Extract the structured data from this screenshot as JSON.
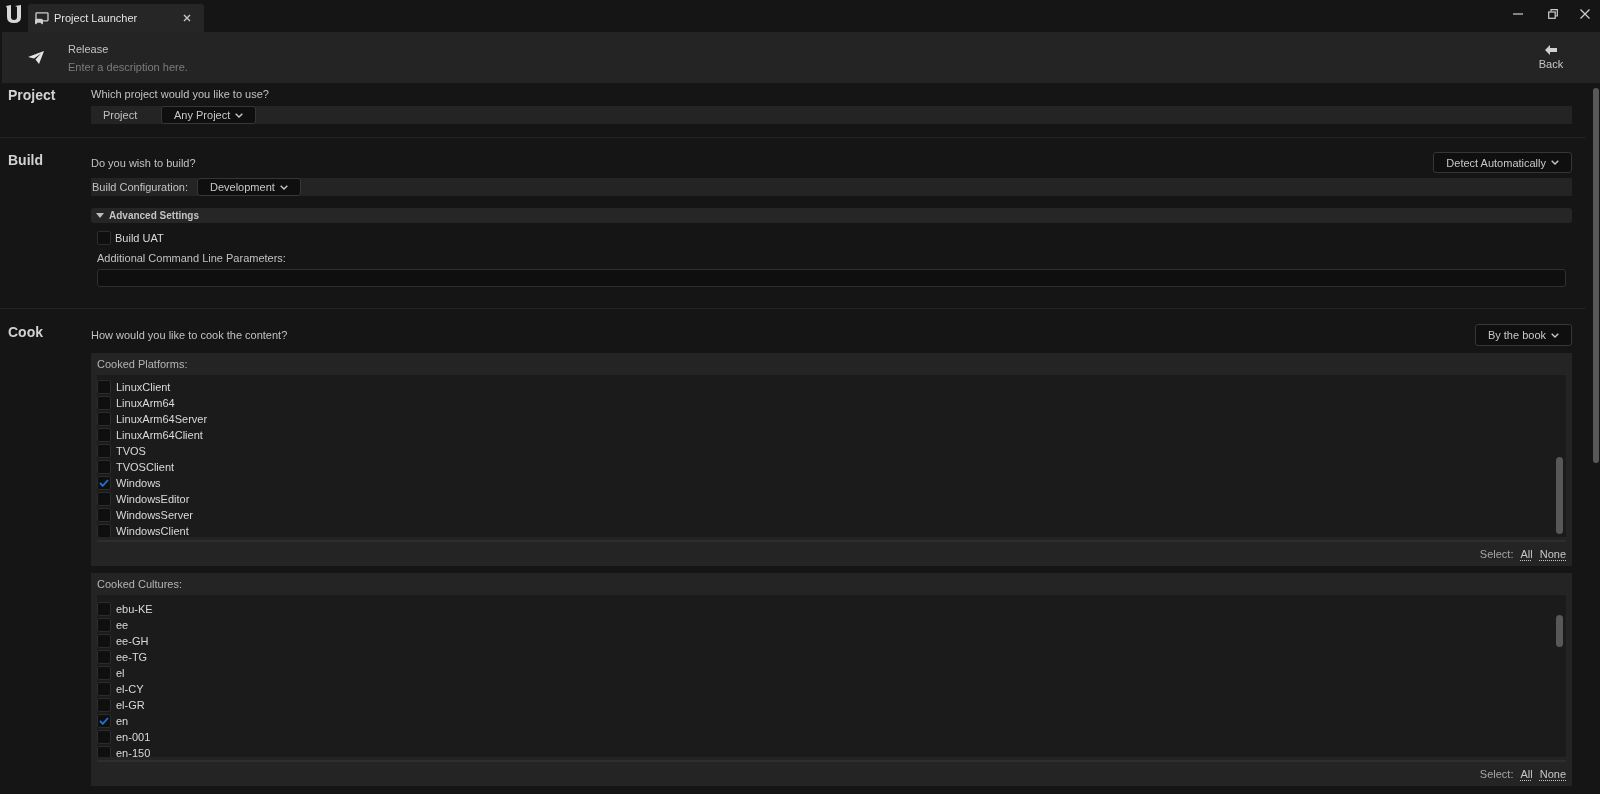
{
  "window": {
    "tab": {
      "title": "Project Launcher",
      "selected": true
    }
  },
  "header": {
    "title": "Release",
    "description": {
      "placeholder": "Enter a description here."
    },
    "back": "Back"
  },
  "project": {
    "title": "Project",
    "question": "Which project would you like to use?",
    "property": {
      "label": "Project",
      "value": "Any Project"
    }
  },
  "build": {
    "title": "Build",
    "question": "Do you wish to build?",
    "mode": "Detect Automatically",
    "property": {
      "label": "Build Configuration:",
      "value": "Development"
    },
    "advanced": {
      "title": "Advanced Settings",
      "expanded": true,
      "options": [
        {
          "label": "Build UAT",
          "checked": false
        }
      ],
      "parameters_label": "Additional Command Line Parameters:"
    }
  },
  "cook": {
    "title": "Cook",
    "question": "How would you like to cook the content?",
    "mode": "By the book",
    "lists": [
      {
        "title": "Cooked Platforms:",
        "items": [
          {
            "label": "LinuxClient",
            "checked": false
          },
          {
            "label": "LinuxArm64",
            "checked": false
          },
          {
            "label": "LinuxArm64Server",
            "checked": false
          },
          {
            "label": "LinuxArm64Client",
            "checked": false
          },
          {
            "label": "TVOS",
            "checked": false
          },
          {
            "label": "TVOSClient",
            "checked": false
          },
          {
            "label": "Windows",
            "checked": true
          },
          {
            "label": "WindowsEditor",
            "checked": false
          },
          {
            "label": "WindowsServer",
            "checked": false
          },
          {
            "label": "WindowsClient",
            "checked": false
          }
        ],
        "select_label": "Select:",
        "links": [
          "All",
          "None"
        ]
      },
      {
        "title": "Cooked Cultures:",
        "items": [
          {
            "label": "ebu-KE",
            "checked": false
          },
          {
            "label": "ee",
            "checked": false
          },
          {
            "label": "ee-GH",
            "checked": false
          },
          {
            "label": "ee-TG",
            "checked": false
          },
          {
            "label": "el",
            "checked": false
          },
          {
            "label": "el-CY",
            "checked": false
          },
          {
            "label": "el-GR",
            "checked": false
          },
          {
            "label": "en",
            "checked": true
          },
          {
            "label": "en-001",
            "checked": false
          },
          {
            "label": "en-150",
            "checked": false
          }
        ],
        "select_label": "Select:",
        "links": [
          "All",
          "None"
        ]
      }
    ]
  }
}
